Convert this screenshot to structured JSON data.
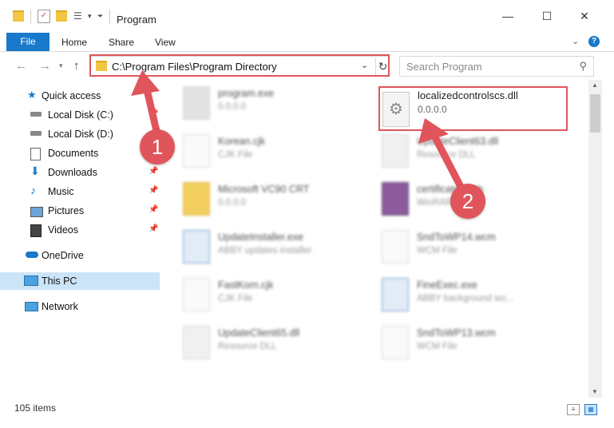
{
  "window": {
    "title": "Program",
    "controls": {
      "minimize": "—",
      "maximize": "☐",
      "close": "✕"
    }
  },
  "ribbon": {
    "tabs": [
      "File",
      "Home",
      "Share",
      "View"
    ],
    "help": "?"
  },
  "navigation": {
    "address": "C:\\Program Files\\Program Directory",
    "search_placeholder": "Search Program"
  },
  "sidebar": {
    "items": [
      {
        "label": "Quick access",
        "icon": "star-icon",
        "pinned": false
      },
      {
        "label": "Local Disk (C:)",
        "icon": "drive-icon",
        "pinned": true
      },
      {
        "label": "Local Disk (D:)",
        "icon": "drive-icon",
        "pinned": true
      },
      {
        "label": "Documents",
        "icon": "documents-icon",
        "pinned": true
      },
      {
        "label": "Downloads",
        "icon": "download-icon",
        "pinned": true
      },
      {
        "label": "Music",
        "icon": "music-icon",
        "pinned": true
      },
      {
        "label": "Pictures",
        "icon": "pictures-icon",
        "pinned": true
      },
      {
        "label": "Videos",
        "icon": "videos-icon",
        "pinned": true
      },
      {
        "label": "OneDrive",
        "icon": "cloud-icon",
        "pinned": false
      },
      {
        "label": "This PC",
        "icon": "pc-icon",
        "pinned": false,
        "selected": true
      },
      {
        "label": "Network",
        "icon": "network-icon",
        "pinned": false
      }
    ]
  },
  "files": {
    "left": [
      {
        "name": "program.exe",
        "desc": "0.0.0.0"
      },
      {
        "name": "Korean.cjk",
        "desc": "CJK File"
      },
      {
        "name": "Microsoft VC90 CRT",
        "desc": "0.0.0.0"
      },
      {
        "name": "UpdateInstaller.exe",
        "desc": "ABBY updates installer"
      },
      {
        "name": "FastKorn.cjk",
        "desc": "CJK File"
      },
      {
        "name": "UpdateClient65.dll",
        "desc": "Resource DLL"
      }
    ],
    "right": [
      {
        "name": "localizedcontrolscs.dll",
        "desc": "0.0.0.0"
      },
      {
        "name": "UpdateClient63.dll",
        "desc": "Resource DLL"
      },
      {
        "name": "certificates.cab",
        "desc": "WinRAR archive"
      },
      {
        "name": "SndToWP14.wcm",
        "desc": "WCM File"
      },
      {
        "name": "FineExec.exe",
        "desc": "ABBY background wo..."
      },
      {
        "name": "SndToWP13.wcm",
        "desc": "WCM File"
      }
    ]
  },
  "status": {
    "item_count": "105 items"
  },
  "callouts": {
    "one": "1",
    "two": "2"
  },
  "colors": {
    "accent": "#1979ca",
    "highlight": "#e0555b",
    "selected_bg": "#cce4f7"
  }
}
